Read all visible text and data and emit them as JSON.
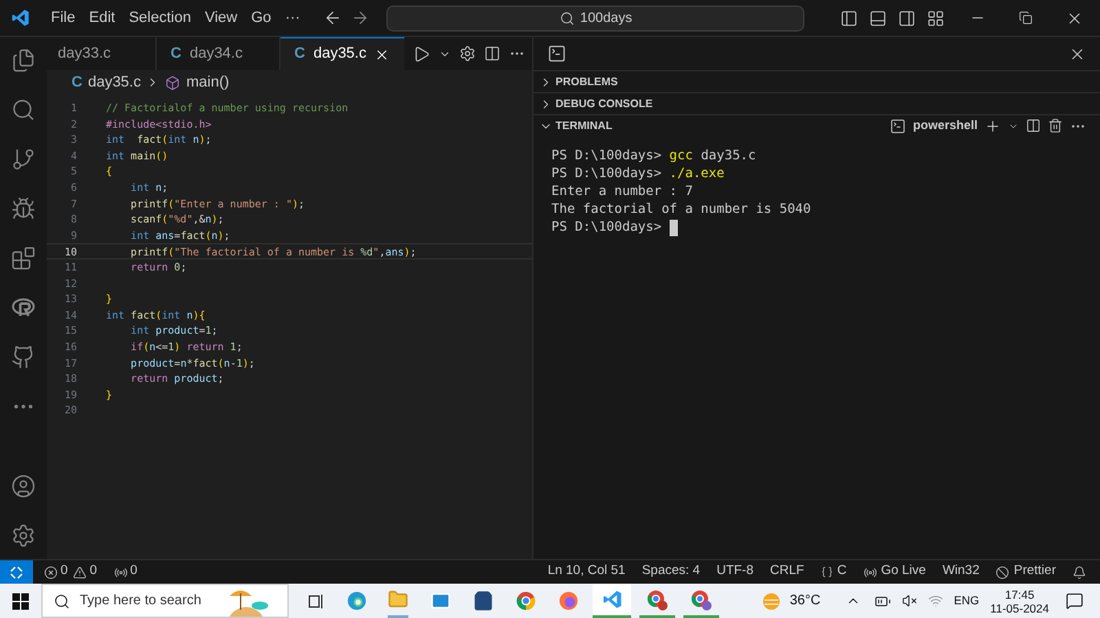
{
  "title_bar": {
    "menu": [
      "File",
      "Edit",
      "Selection",
      "View",
      "Go",
      "···"
    ],
    "search": "100days"
  },
  "tabs": [
    {
      "label": "day33.c",
      "selected": false
    },
    {
      "label": "day34.c",
      "icon": "C",
      "selected": false
    },
    {
      "label": "day35.c",
      "icon": "C",
      "selected": true
    }
  ],
  "breadcrumbs": {
    "icon": "C",
    "file": "day35.c",
    "symbol": "main()"
  },
  "code": [
    {
      "number": "1",
      "current": false,
      "tokens": [
        {
          "kind": "comment",
          "text": "// Factorialof a number using recursion"
        }
      ]
    },
    {
      "number": "2",
      "current": false,
      "tokens": [
        {
          "kind": "directive",
          "text": "#include<stdio.h>"
        }
      ]
    },
    {
      "number": "3",
      "current": false,
      "tokens": [
        {
          "kind": "keyword",
          "text": "int"
        },
        {
          "kind": "function",
          "text": "  fact"
        },
        {
          "kind": "bracket",
          "text": "("
        },
        {
          "kind": "keyword",
          "text": "int"
        },
        {
          "kind": "variable",
          "text": " n"
        },
        {
          "kind": "bracket",
          "text": ")"
        },
        {
          "kind": "plain",
          "text": ";"
        }
      ]
    },
    {
      "number": "4",
      "current": false,
      "tokens": [
        {
          "kind": "keyword",
          "text": "int"
        },
        {
          "kind": "function",
          "text": " main"
        },
        {
          "kind": "bracket",
          "text": "()"
        }
      ]
    },
    {
      "number": "5",
      "current": false,
      "tokens": [
        {
          "kind": "bracket",
          "text": "{"
        }
      ]
    },
    {
      "number": "6",
      "current": false,
      "tokens": [
        {
          "kind": "keyword",
          "text": "    int"
        },
        {
          "kind": "variable",
          "text": " n"
        },
        {
          "kind": "plain",
          "text": ";"
        }
      ]
    },
    {
      "number": "7",
      "current": false,
      "tokens": [
        {
          "kind": "function",
          "text": "    printf"
        },
        {
          "kind": "bracket",
          "text": "("
        },
        {
          "kind": "string",
          "text": "\"Enter a number : \""
        },
        {
          "kind": "bracket",
          "text": ")"
        },
        {
          "kind": "plain",
          "text": ";"
        }
      ]
    },
    {
      "number": "8",
      "current": false,
      "tokens": [
        {
          "kind": "function",
          "text": "    scanf"
        },
        {
          "kind": "bracket",
          "text": "("
        },
        {
          "kind": "string",
          "text": "\"%d\""
        },
        {
          "kind": "plain",
          "text": ",&"
        },
        {
          "kind": "variable",
          "text": "n"
        },
        {
          "kind": "bracket",
          "text": ")"
        },
        {
          "kind": "plain",
          "text": ";"
        }
      ]
    },
    {
      "number": "9",
      "current": false,
      "tokens": [
        {
          "kind": "keyword",
          "text": "    int"
        },
        {
          "kind": "variable",
          "text": " ans"
        },
        {
          "kind": "plain",
          "text": "="
        },
        {
          "kind": "function",
          "text": "fact"
        },
        {
          "kind": "bracket",
          "text": "("
        },
        {
          "kind": "variable",
          "text": "n"
        },
        {
          "kind": "bracket",
          "text": ")"
        },
        {
          "kind": "plain",
          "text": ";"
        }
      ]
    },
    {
      "number": "10",
      "current": true,
      "tokens": [
        {
          "kind": "function",
          "text": "    printf"
        },
        {
          "kind": "bracket",
          "text": "("
        },
        {
          "kind": "string",
          "text": "\"The factorial of a number is "
        },
        {
          "kind": "number",
          "text": "%d"
        },
        {
          "kind": "string",
          "text": "\""
        },
        {
          "kind": "plain",
          "text": ","
        },
        {
          "kind": "variable",
          "text": "ans"
        },
        {
          "kind": "bracket",
          "text": ")"
        },
        {
          "kind": "plain",
          "text": ";"
        }
      ]
    },
    {
      "number": "11",
      "current": false,
      "tokens": [
        {
          "kind": "control",
          "text": "    return"
        },
        {
          "kind": "number",
          "text": " 0"
        },
        {
          "kind": "plain",
          "text": ";"
        }
      ]
    },
    {
      "number": "12",
      "current": false
    },
    {
      "number": "13",
      "current": false,
      "tokens": [
        {
          "kind": "bracket",
          "text": "}"
        }
      ]
    },
    {
      "number": "14",
      "current": false,
      "tokens": [
        {
          "kind": "keyword",
          "text": "int"
        },
        {
          "kind": "function",
          "text": " fact"
        },
        {
          "kind": "bracket",
          "text": "("
        },
        {
          "kind": "keyword",
          "text": "int"
        },
        {
          "kind": "variable",
          "text": " n"
        },
        {
          "kind": "bracket",
          "text": "){"
        }
      ]
    },
    {
      "number": "15",
      "current": false,
      "tokens": [
        {
          "kind": "keyword",
          "text": "    int"
        },
        {
          "kind": "variable",
          "text": " product"
        },
        {
          "kind": "plain",
          "text": "="
        },
        {
          "kind": "number",
          "text": "1"
        },
        {
          "kind": "plain",
          "text": ";"
        }
      ]
    },
    {
      "number": "16",
      "current": false,
      "tokens": [
        {
          "kind": "control",
          "text": "    if"
        },
        {
          "kind": "bracket",
          "text": "("
        },
        {
          "kind": "variable",
          "text": "n"
        },
        {
          "kind": "plain",
          "text": "<="
        },
        {
          "kind": "number",
          "text": "1"
        },
        {
          "kind": "bracket",
          "text": ")"
        },
        {
          "kind": "control",
          "text": " return"
        },
        {
          "kind": "number",
          "text": " 1"
        },
        {
          "kind": "plain",
          "text": ";"
        }
      ]
    },
    {
      "number": "17",
      "current": false,
      "tokens": [
        {
          "kind": "variable",
          "text": "    product"
        },
        {
          "kind": "plain",
          "text": "="
        },
        {
          "kind": "variable",
          "text": "n"
        },
        {
          "kind": "plain",
          "text": "*"
        },
        {
          "kind": "function",
          "text": "fact"
        },
        {
          "kind": "bracket",
          "text": "("
        },
        {
          "kind": "variable",
          "text": "n"
        },
        {
          "kind": "plain",
          "text": "-"
        },
        {
          "kind": "number",
          "text": "1"
        },
        {
          "kind": "bracket",
          "text": ")"
        },
        {
          "kind": "plain",
          "text": ";"
        }
      ]
    },
    {
      "number": "18",
      "current": false,
      "tokens": [
        {
          "kind": "control",
          "text": "    return"
        },
        {
          "kind": "variable",
          "text": " product"
        },
        {
          "kind": "plain",
          "text": ";"
        }
      ]
    },
    {
      "number": "19",
      "current": false,
      "tokens": [
        {
          "kind": "bracket",
          "text": "}"
        }
      ]
    },
    {
      "number": "20",
      "current": false
    }
  ],
  "panel": {
    "sections": [
      {
        "label": "PROBLEMS",
        "expanded": false
      },
      {
        "label": "DEBUG CONSOLE",
        "expanded": false
      },
      {
        "label": "TERMINAL",
        "expanded": true
      }
    ],
    "terminal_profile": "powershell",
    "terminal": [
      {
        "cursor": false,
        "tokens": [
          {
            "kind": "prompt",
            "text": "PS D:\\100days> "
          },
          {
            "kind": "command",
            "text": "gcc"
          },
          {
            "kind": "output",
            "text": " day35.c"
          }
        ]
      },
      {
        "cursor": false,
        "tokens": [
          {
            "kind": "prompt",
            "text": "PS D:\\100days> "
          },
          {
            "kind": "command",
            "text": "./a.exe"
          }
        ]
      },
      {
        "cursor": false,
        "tokens": [
          {
            "kind": "output",
            "text": "Enter a number : 7"
          }
        ]
      },
      {
        "cursor": false,
        "tokens": [
          {
            "kind": "output",
            "text": "The factorial of a number is 5040"
          }
        ]
      },
      {
        "cursor": true,
        "tokens": [
          {
            "kind": "prompt",
            "text": "PS D:\\100days> "
          }
        ]
      }
    ]
  },
  "status_bar": {
    "errors": "0",
    "warnings": "0",
    "ports": "0",
    "items": [
      {
        "kind": "text",
        "text": "Ln 10, Col 51"
      },
      {
        "kind": "text",
        "text": "Spaces: 4"
      },
      {
        "kind": "text",
        "text": "UTF-8"
      },
      {
        "kind": "text",
        "text": "CRLF"
      },
      {
        "kind": "language",
        "text": "C"
      },
      {
        "kind": "live",
        "text": "Go Live"
      },
      {
        "kind": "text",
        "text": "Win32"
      },
      {
        "kind": "formatter",
        "text": "Prettier"
      }
    ]
  },
  "taskbar": {
    "search_placeholder": "Type here to search",
    "weather": "36°C",
    "language": "ENG",
    "time": "17:45",
    "date": "11-05-2024"
  }
}
